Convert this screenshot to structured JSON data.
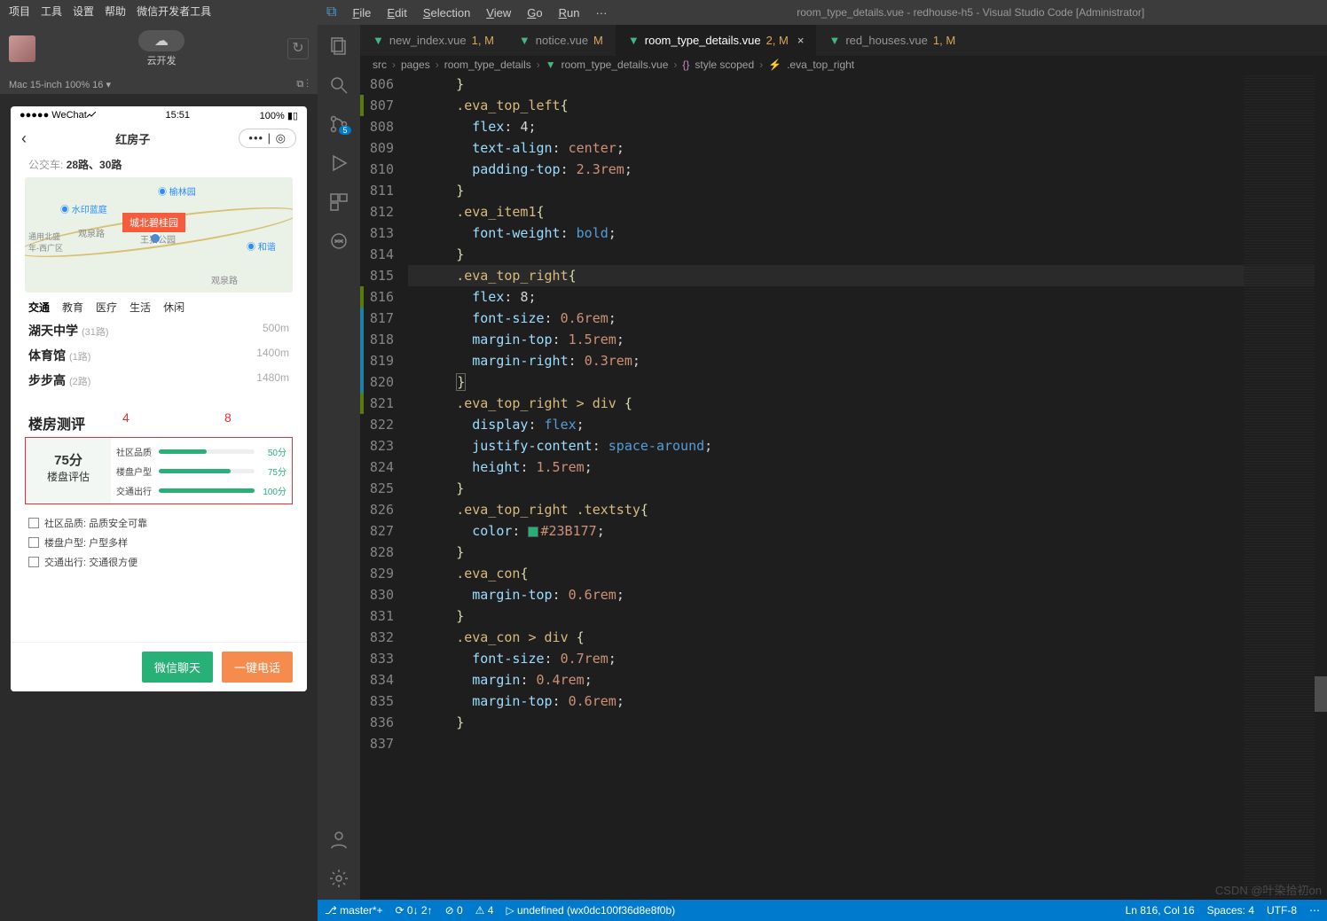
{
  "devtools": {
    "menu": [
      "项目",
      "工具",
      "设置",
      "帮助",
      "微信开发者工具"
    ],
    "cloud_label": "云开发",
    "device": "Mac 15-inch 100% 16",
    "cloud_icon_glyph": "☁"
  },
  "simulator": {
    "status_left": "●●●●● WeChat",
    "status_time": "15:51",
    "status_right": "100%",
    "nav_title": "红房子",
    "bus_label": "公交车:",
    "bus_lines": "28路、30路",
    "map_pin": "城北碧桂园",
    "map_pois": {
      "a": "榆林园",
      "b": "水印蓝庭",
      "c": "和谐",
      "d": "观泉路",
      "e": "王猫公园",
      "f": "通用北盛",
      "g": "年-西广区"
    },
    "tabs": [
      "交通",
      "教育",
      "医疗",
      "生活",
      "休闲"
    ],
    "poi_list": [
      {
        "name": "湖天中学",
        "sub": "(31路)",
        "dist": "500m"
      },
      {
        "name": "体育馆",
        "sub": "(1路)",
        "dist": "1400m"
      },
      {
        "name": "步步高",
        "sub": "(2路)",
        "dist": "1480m"
      }
    ],
    "review_title": "楼房测评",
    "ann4": "4",
    "ann8": "8",
    "score": "75分",
    "score_label": "楼盘评估",
    "eva_rows": [
      {
        "label": "社区品质",
        "pct": 50,
        "val": "50分"
      },
      {
        "label": "楼盘户型",
        "pct": 75,
        "val": "75分"
      },
      {
        "label": "交通出行",
        "pct": 100,
        "val": "100分"
      }
    ],
    "details": [
      "社区品质: 品质安全可靠",
      "楼盘户型: 户型多样",
      "交通出行: 交通很方便"
    ],
    "btn_chat": "微信聊天",
    "btn_call": "一键电话"
  },
  "vscode": {
    "menu": [
      "File",
      "Edit",
      "Selection",
      "View",
      "Go",
      "Run",
      "···"
    ],
    "title": "room_type_details.vue - redhouse-h5 - Visual Studio Code [Administrator]",
    "scm_badge": "5",
    "tabs": [
      {
        "name": "new_index.vue",
        "suffix": "1, M",
        "active": false
      },
      {
        "name": "notice.vue",
        "suffix": "M",
        "active": false
      },
      {
        "name": "room_type_details.vue",
        "suffix": "2, M",
        "active": true
      },
      {
        "name": "red_houses.vue",
        "suffix": "1, M",
        "active": false
      }
    ],
    "breadcrumb": {
      "a": "src",
      "b": "pages",
      "c": "room_type_details",
      "d": "room_type_details.vue",
      "e": "style scoped",
      "f": ".eva_top_right"
    },
    "code": {
      "line_start": 806,
      "marks": [
        "",
        "green",
        "",
        "",
        "",
        "",
        "",
        "",
        "",
        "",
        "green",
        "blue",
        "blue",
        "blue",
        "blue",
        "green",
        "",
        "",
        "",
        "",
        "",
        "",
        "",
        "",
        "",
        "",
        "",
        "",
        "",
        "",
        "",
        ""
      ],
      "lines": {
        "806": {
          "t": "      }"
        },
        "807": {
          "t": ""
        },
        "808": {
          "sel": ".eva_top_left",
          "open": "{"
        },
        "809": {
          "prop": "flex",
          "val": "4",
          "num": true
        },
        "810": {
          "prop": "text-align",
          "val": "center"
        },
        "811": {
          "prop": "padding-top",
          "val": "2.3rem"
        },
        "812": {
          "close": "}"
        },
        "813": {
          "sel": ".eva_item1",
          "open": "{"
        },
        "814": {
          "prop": "font-weight",
          "valk": "bold"
        },
        "815": {
          "close": "}"
        },
        "816": {
          "sel": ".eva_top_right",
          "open": "{",
          "hl": true
        },
        "817": {
          "prop": "flex",
          "val": "8",
          "num": true
        },
        "818": {
          "prop": "font-size",
          "val": "0.6rem"
        },
        "819": {
          "prop": "margin-top",
          "val": "1.5rem"
        },
        "820": {
          "prop": "margin-right",
          "val": "0.3rem"
        },
        "821": {
          "close": "}",
          "hl_brace": true
        },
        "822": {
          "sel": ".eva_top_right > div ",
          "open": "{"
        },
        "823": {
          "prop": "display",
          "valk": "flex"
        },
        "824": {
          "prop": "justify-content",
          "valk": "space-around"
        },
        "825": {
          "prop": "height",
          "val": "1.5rem"
        },
        "826": {
          "close": "}"
        },
        "827": {
          "sel": ".eva_top_right .textsty",
          "open": "{"
        },
        "828": {
          "prop": "color",
          "valc": "#23B177"
        },
        "829": {
          "close": "}"
        },
        "830": {
          "sel": ".eva_con",
          "open": "{"
        },
        "831": {
          "prop": "margin-top",
          "val": "0.6rem"
        },
        "832": {
          "close": "}"
        },
        "833": {
          "sel": ".eva_con > div ",
          "open": "{"
        },
        "834": {
          "prop": "font-size",
          "val": "0.7rem"
        },
        "835": {
          "prop": "margin",
          "val": "0.4rem"
        },
        "836": {
          "prop": "margin-top",
          "val": "0.6rem"
        },
        "837": {
          "close": "}"
        }
      }
    },
    "status": {
      "branch": "master*+",
      "sync": "0↓ 2↑",
      "errors": "⊘ 0",
      "warnings": "⚠ 4",
      "debug": "undefined (wx0dc100f36d8e8f0b)",
      "pos": "Ln 816, Col 16",
      "spaces": "Spaces: 4",
      "enc": "UTF-8",
      "watermark": "CSDN @叶染拾初on"
    }
  }
}
